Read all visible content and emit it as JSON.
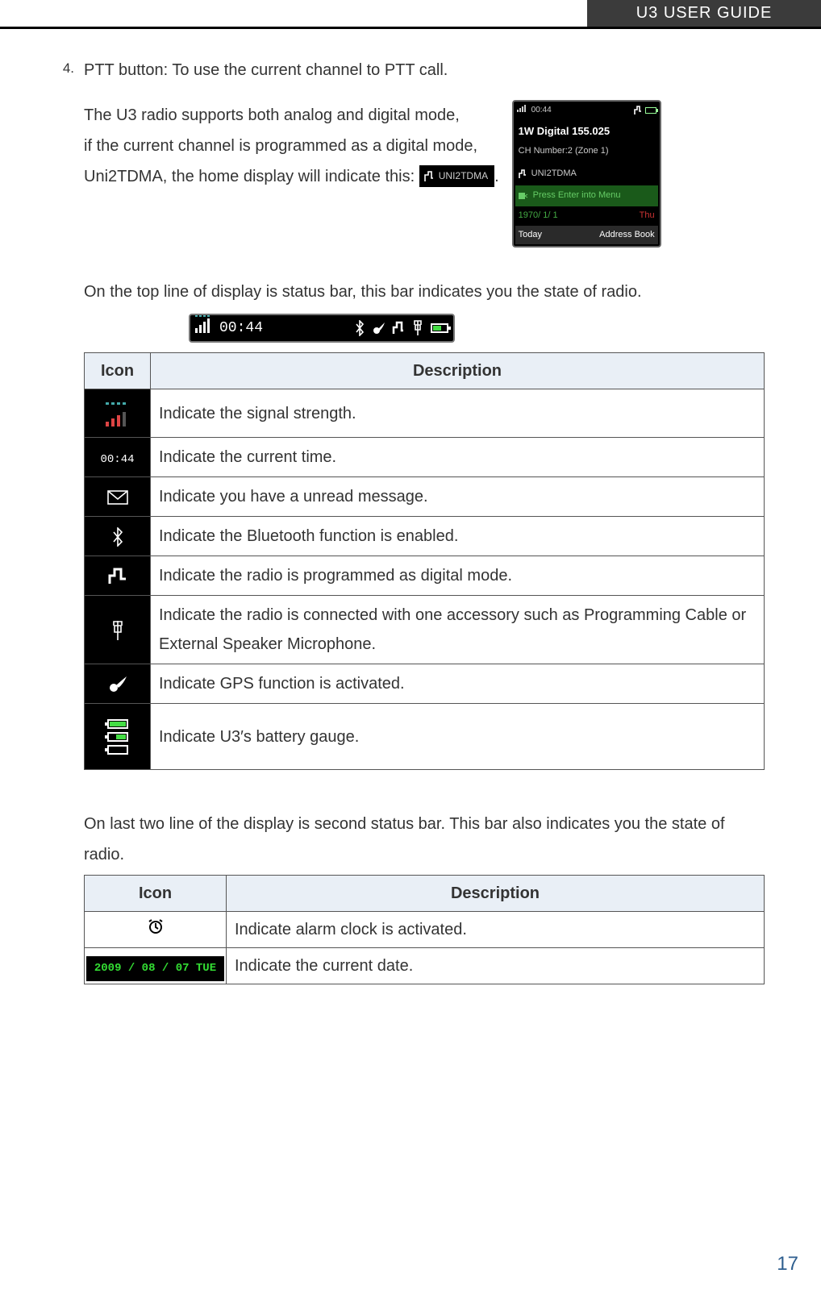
{
  "header": {
    "title": "U3 USER GUIDE"
  },
  "list": {
    "number": "4.",
    "text": "PTT button: To use the current channel to PTT call."
  },
  "digital_para": {
    "line1": "The U3 radio supports both analog and digital mode,",
    "line2": "if the current channel is programmed as a digital mode,",
    "line3a": "Uni2TDMA, the home display will indicate this:",
    "chip": "UNI2TDMA",
    "line3b": "."
  },
  "radio_screen": {
    "time": "00:44",
    "title": "1W Digital 155.025",
    "ch": "CH Number:2 (Zone 1)",
    "mode": "UNI2TDMA",
    "hint": "Press Enter into Menu",
    "date": "1970/ 1/ 1",
    "day": "Thu",
    "left": "Today",
    "right": "Address Book"
  },
  "status_intro": "On the top line of display is status bar, this bar indicates you the state of radio.",
  "status_bar": {
    "time": "00:44"
  },
  "table1": {
    "head_icon": "Icon",
    "head_desc": "Description",
    "rows": [
      {
        "name": "signal-icon",
        "desc": "Indicate the signal strength."
      },
      {
        "name": "time-icon",
        "desc": "Indicate the current time.",
        "text": "00:44"
      },
      {
        "name": "message-icon",
        "desc": "Indicate you have a unread message."
      },
      {
        "name": "bluetooth-icon",
        "desc": "Indicate the Bluetooth function is enabled."
      },
      {
        "name": "digital-icon",
        "desc": "Indicate the radio is programmed as digital mode."
      },
      {
        "name": "accessory-icon",
        "desc": "Indicate the radio is connected with one accessory such as Programming Cable or External Speaker Microphone."
      },
      {
        "name": "gps-icon",
        "desc": "Indicate GPS function is activated."
      },
      {
        "name": "battery-icon",
        "desc": "Indicate U3′s battery gauge."
      }
    ]
  },
  "second_intro": "On last two line of the display is second status bar. This bar also indicates you the state of radio.",
  "table2": {
    "head_icon": "Icon",
    "head_desc": "Description",
    "rows": [
      {
        "name": "alarm-icon",
        "desc": "Indicate alarm clock is activated."
      },
      {
        "name": "date-icon",
        "desc": "Indicate the current date.",
        "text": "2009 / 08 / 07   TUE"
      }
    ]
  },
  "page_number": "17"
}
